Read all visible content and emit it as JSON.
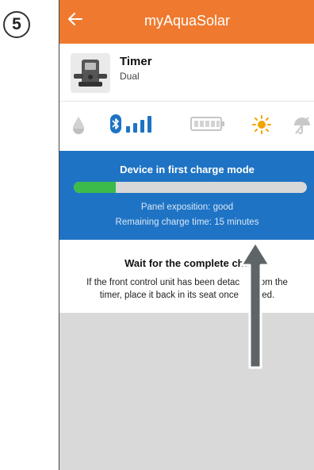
{
  "step_number": "5",
  "appbar": {
    "title": "myAquaSolar",
    "back_icon": "arrow-left-icon"
  },
  "device": {
    "name": "Timer",
    "type": "Dual",
    "thumbnail_icon": "timer-device-icon"
  },
  "status_icons": [
    "water-drop-icon",
    "bluetooth-icon",
    "signal-bars-icon",
    "battery-icon",
    "sun-icon",
    "umbrella-icon"
  ],
  "charge": {
    "title": "Device in first charge mode",
    "progress": 0.18,
    "panel_exposition": "Panel exposition: good",
    "remaining_time": "Remaining charge time: 15 minutes"
  },
  "info": {
    "title": "Wait for the complete cha",
    "body_line1": "If the front control unit has been detac    l from the",
    "body_line2": "timer, place it back in its seat once    arged."
  },
  "colors": {
    "appbar": "#ef7a2f",
    "panel": "#1f73c4",
    "progress_fill": "#3dbb4a",
    "bluetooth": "#1f73c4",
    "sun": "#f2a400",
    "arrow": "#5f6567"
  }
}
